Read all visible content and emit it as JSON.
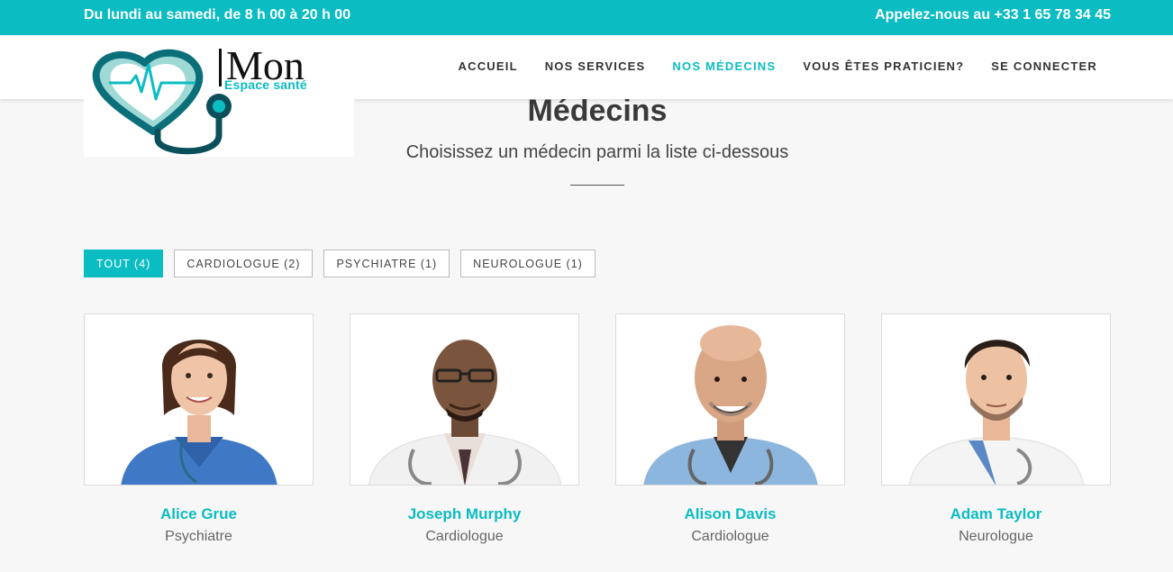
{
  "topbar": {
    "hours": "Du lundi au samedi, de 8 h 00 à 20 h 00",
    "phone": "Appelez-nous au +33 1 65 78 34 45"
  },
  "logo": {
    "title": "Mon",
    "subtitle": "Espace santé"
  },
  "nav": {
    "items": [
      {
        "label": "ACCUEIL",
        "active": false
      },
      {
        "label": "NOS SERVICES",
        "active": false
      },
      {
        "label": "NOS MÉDECINS",
        "active": true
      },
      {
        "label": "VOUS ÊTES PRATICIEN?",
        "active": false
      },
      {
        "label": "SE CONNECTER",
        "active": false
      }
    ]
  },
  "page": {
    "title": "Médecins",
    "subtitle": "Choisissez un médecin parmi la liste ci-dessous"
  },
  "filters": [
    {
      "label": "TOUT (4)",
      "active": true
    },
    {
      "label": "CARDIOLOGUE (2)",
      "active": false
    },
    {
      "label": "PSYCHIATRE (1)",
      "active": false
    },
    {
      "label": "NEUROLOGUE (1)",
      "active": false
    }
  ],
  "doctors": [
    {
      "name": "Alice Grue",
      "specialty": "Psychiatre"
    },
    {
      "name": "Joseph Murphy",
      "specialty": "Cardiologue"
    },
    {
      "name": "Alison Davis",
      "specialty": "Cardiologue"
    },
    {
      "name": "Adam Taylor",
      "specialty": "Neurologue"
    }
  ],
  "colors": {
    "accent": "#0bbcc2",
    "background": "#f7f7f7",
    "text": "#333333"
  },
  "icons": [
    "stethoscope-heart-logo"
  ]
}
